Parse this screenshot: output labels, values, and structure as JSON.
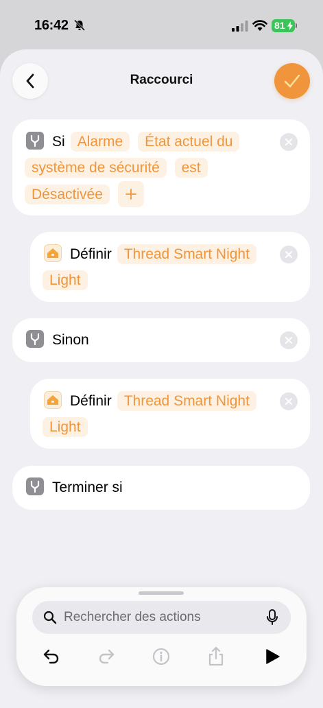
{
  "status_bar": {
    "time": "16:42",
    "battery": "81"
  },
  "header": {
    "title": "Raccourci"
  },
  "blocks": [
    {
      "keyword": "Si",
      "tokens": [
        "Alarme",
        "État actuel du système de sécurité",
        "est",
        "Désactivée"
      ]
    },
    {
      "keyword": "Définir",
      "tokens": [
        "Thread Smart Night Light"
      ]
    },
    {
      "keyword": "Sinon"
    },
    {
      "keyword": "Définir",
      "tokens": [
        "Thread Smart Night Light"
      ]
    },
    {
      "keyword": "Terminer si"
    }
  ],
  "toolbar": {
    "search_placeholder": "Rechercher des actions"
  },
  "icons": {
    "branch": "branch-icon",
    "home": "home-icon",
    "remove": "close-icon",
    "undo": "undo-icon",
    "redo": "redo-icon",
    "info": "info-icon",
    "share": "share-icon",
    "play": "play-icon",
    "search": "search-icon",
    "mic": "mic-icon"
  },
  "colors": {
    "accent": "#f0953b",
    "chip_bg": "#fdf1e3",
    "background": "#efeff4",
    "card": "#ffffff"
  }
}
